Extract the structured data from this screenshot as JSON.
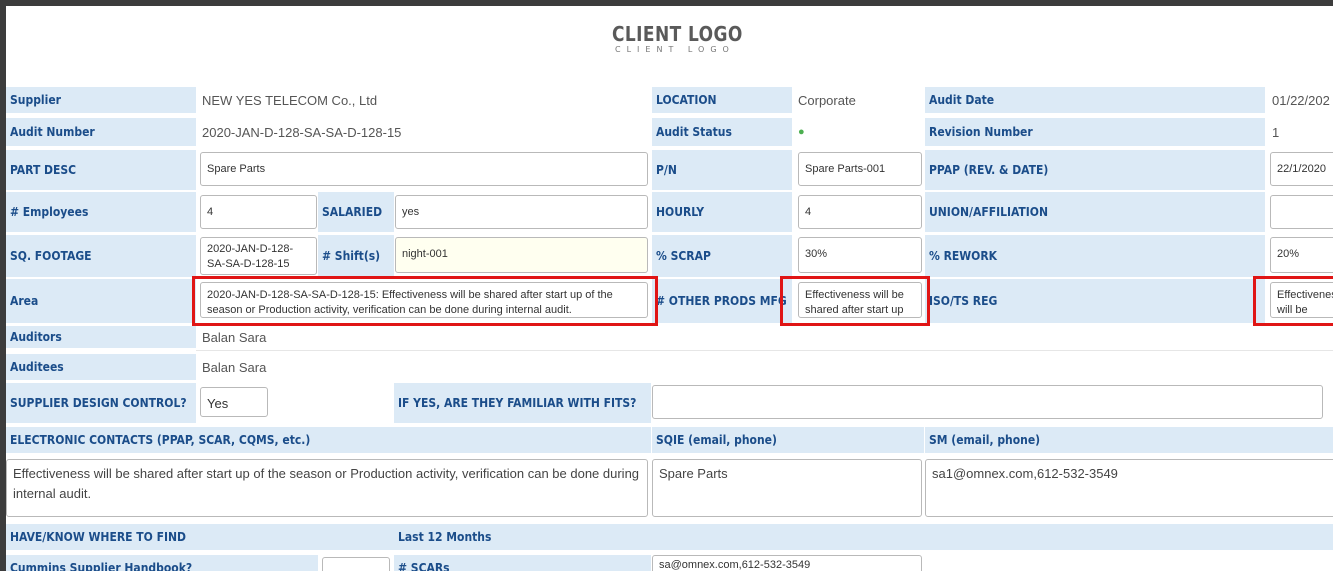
{
  "logo": {
    "title": "CLIENT LOGO",
    "subtitle": "CLIENT LOGO"
  },
  "colors": {
    "label_bg": "#dceaf6",
    "label_text": "#1b4d8a",
    "status_dot": "#4caf50",
    "highlight": "#e01515"
  },
  "rows": {
    "supplier": {
      "label": "Supplier",
      "value": "NEW YES TELECOM Co., Ltd"
    },
    "location": {
      "label": "LOCATION",
      "value": "Corporate"
    },
    "audit_date": {
      "label": "Audit Date",
      "value": "01/22/202"
    },
    "audit_number": {
      "label": "Audit Number",
      "value": "2020-JAN-D-128-SA-SA-D-128-15"
    },
    "audit_status": {
      "label": "Audit Status",
      "value": "●"
    },
    "revision_number": {
      "label": "Revision Number",
      "value": "1"
    },
    "part_desc": {
      "label": "PART DESC",
      "value": "Spare Parts"
    },
    "pn": {
      "label": "P/N",
      "value": "Spare Parts-001"
    },
    "ppap": {
      "label": "PPAP (REV. & DATE)",
      "value": "22/1/2020"
    },
    "employees": {
      "label": "# Employees",
      "value": "4"
    },
    "salaried": {
      "label": "SALARIED",
      "value": "yes"
    },
    "hourly": {
      "label": "HOURLY",
      "value": "4"
    },
    "union": {
      "label": "UNION/AFFILIATION",
      "value": ""
    },
    "sq_footage": {
      "label": "SQ. FOOTAGE",
      "value": "2020-JAN-D-128-SA-SA-D-128-15"
    },
    "shifts": {
      "label": "# Shift(s)",
      "value": "night-001"
    },
    "scrap": {
      "label": "% SCRAP",
      "value": "30%"
    },
    "rework": {
      "label": "% REWORK",
      "value": "20%"
    },
    "area": {
      "label": "Area",
      "value": "2020-JAN-D-128-SA-SA-D-128-15: Effectiveness will be shared after start up of the season or Production activity, verification can be done during internal audit."
    },
    "other_prods": {
      "label": "# OTHER PRODS MFG",
      "value": "Effectiveness will be shared after start up"
    },
    "iso_ts": {
      "label": "ISO/TS REG",
      "value": "Effectiveness will be"
    },
    "auditors": {
      "label": "Auditors",
      "value": "Balan Sara"
    },
    "auditees": {
      "label": "Auditees",
      "value": "Balan Sara"
    },
    "design_control": {
      "label": "SUPPLIER DESIGN CONTROL?",
      "value": "Yes"
    },
    "fits": {
      "label": "IF YES, ARE THEY FAMILIAR WITH FITS?",
      "value": ""
    },
    "electronic_contacts": {
      "label": "ELECTRONIC CONTACTS (PPAP, SCAR, CQMS, etc.)",
      "value": "Effectiveness will be shared after start up of the season or Production activity, verification can be done during internal audit."
    },
    "sqie": {
      "label": "SQIE (email, phone)",
      "value": "Spare Parts"
    },
    "sm": {
      "label": "SM (email, phone)",
      "value": "sa1@omnex.com,612-532-3549"
    },
    "have_know": {
      "label": "HAVE/KNOW WHERE TO FIND"
    },
    "last12": {
      "label": "Last 12 Months"
    },
    "handbook": {
      "label": "Cummins Supplier Handbook?"
    },
    "scars": {
      "label": "# SCARs",
      "value": "sa@omnex.com,612-532-3549"
    }
  }
}
